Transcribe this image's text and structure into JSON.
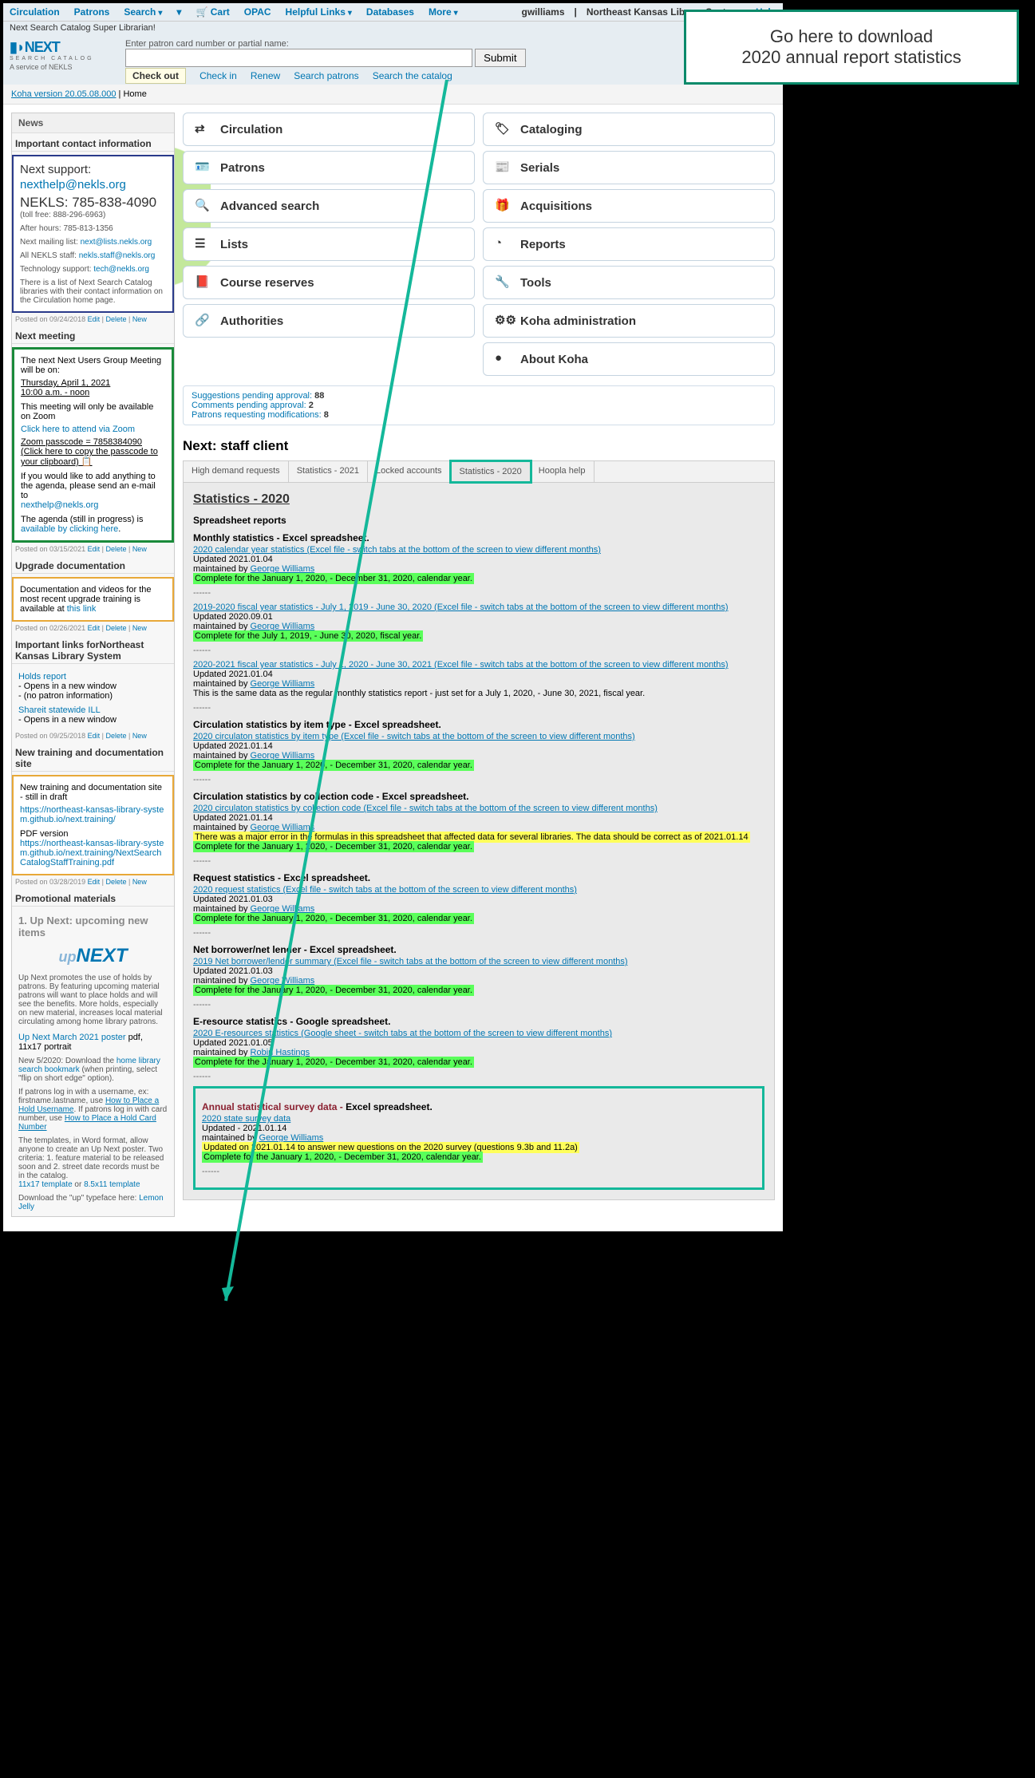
{
  "topnav": {
    "items": [
      "Circulation",
      "Patrons",
      "Search",
      "",
      "Cart",
      "OPAC",
      "Helpful Links",
      "Databases",
      "More"
    ],
    "cart_icon": "cart-icon",
    "user": "gwilliams",
    "system": "Northeast Kansas Library System",
    "help": "Help"
  },
  "superbar": "Next Search Catalog Super Librarian!",
  "logo": {
    "title": "NEXT",
    "subtitle": "SEARCH CATALOG",
    "service": "A service of NEKLS"
  },
  "search": {
    "label": "Enter patron card number or partial name:",
    "submit": "Submit",
    "tabs": {
      "checkout": "Check out",
      "checkin": "Check in",
      "renew": "Renew",
      "searchp": "Search patrons",
      "searchc": "Search the catalog"
    }
  },
  "breadcrumb": {
    "koha": "Koha version 20.05.08.000",
    "home": "Home"
  },
  "callout": {
    "line1": "Go here to download",
    "line2": "2020 annual report statistics"
  },
  "news_h": "News",
  "contact": {
    "h": "Important contact information",
    "support_h": "Next support:",
    "support_email": "nexthelp@nekls.org",
    "phone": "NEKLS: 785-838-4090",
    "tollfree": "(toll free: 888-296-6963)",
    "after": "After hours: 785-813-1356",
    "ml_label": "Next mailing list: ",
    "ml_link": "next@lists.nekls.org",
    "staff_label": "All NEKLS staff: ",
    "staff_link": "nekls.staff@nekls.org",
    "tech_label": "Technology support: ",
    "tech_link": "tech@nekls.org",
    "blurb": "There is a list of Next Search Catalog libraries with their contact information on the Circulation home page.",
    "posted": "Posted on 09/24/2018"
  },
  "meeting": {
    "h": "Next meeting",
    "l1": "The next Next Users Group Meeting will be on:",
    "date": "Thursday, April 1, 2021",
    "time": "10:00 a.m. - noon",
    "zoom_only": "This meeting will only be available on Zoom",
    "zoom_link": "Click here to attend via Zoom",
    "pass": "Zoom passcode = 7858384090 (Click here to copy the passcode to your clipboard)",
    "agenda1": "If you would like to add anything to the agenda, please send an e-mail to",
    "agenda_email": "nexthelp@nekls.org",
    "agenda2": "The agenda (still in progress) is ",
    "agenda_link": "available by clicking here",
    "posted": "Posted on 03/15/2021"
  },
  "upgrade": {
    "h": "Upgrade documentation",
    "text": "Documentation and videos for the most recent upgrade training is available at ",
    "link": "this link",
    "posted": "Posted on 02/26/2021"
  },
  "links": {
    "h": "Important links forNortheast Kansas Library System",
    "holds": "Holds report",
    "holds1": "- Opens in a new window",
    "holds2": "- (no patron information)",
    "ill": "Shareit statewide ILL",
    "ill1": "- Opens in a new window",
    "posted": "Posted on 09/25/2018"
  },
  "training": {
    "h": "New training and documentation site",
    "l1": "New training and documentation site - still in draft",
    "link1": "https://northeast-kansas-library-system.github.io/next.training/",
    "pdf": "PDF version",
    "link2": "https://northeast-kansas-library-system.github.io/next.training/NextSearchCatalogStaffTraining.pdf",
    "posted": "Posted on 03/28/2019"
  },
  "promo": {
    "h": "Promotional materials",
    "sub": "1. Up Next: upcoming new items",
    "blurb": "Up Next promotes the use of holds by patrons. By featuring upcoming material patrons will want to place holds and will see the benefits. More holds, especially on new material, increases local material circulating among home library patrons.",
    "poster_label": "Up Next March 2021 poster",
    "poster_fmt": " pdf, 11x17 portrait",
    "dl": "New 5/2020: Download the ",
    "dl_link": "home library search bookmark",
    "dl_end": " (when printing, select \"flip on short edge\" option).",
    "userlog": "If patrons log in with a username, ex: firstname.lastname, use ",
    "userlog_link": "How to Place a Hold Username",
    "cardlog": ". If patrons log in with card number, use ",
    "cardlog_link": "How to Place a Hold Card Number",
    "templates": "The templates, in Word format, allow anyone to create an Up Next poster. Two criteria: 1. feature material to be released soon and 2. street date records must be in the catalog.",
    "t1": "11x17 template",
    "or": " or ",
    "t2": "8.5x11 template",
    "typeface": "Download the \"up\" typeface here: ",
    "typeface_link": "Lemon Jelly"
  },
  "modules": {
    "left": [
      "Circulation",
      "Patrons",
      "Advanced search",
      "Lists",
      "Course reserves",
      "Authorities"
    ],
    "right": [
      "Cataloging",
      "Serials",
      "Acquisitions",
      "Reports",
      "Tools",
      "Koha administration",
      "About Koha"
    ]
  },
  "alerts": {
    "sugg": "Suggestions pending approval: ",
    "sugg_n": "88",
    "comm": "Comments pending approval: ",
    "comm_n": "2",
    "patr": "Patrons requesting modifications: ",
    "patr_n": "8"
  },
  "staff_h": "Next: staff client",
  "tabs": [
    "High demand requests",
    "Statistics - 2021",
    "Locked accounts",
    "Statistics - 2020",
    "Hoopla help"
  ],
  "stats": {
    "title": "Statistics - 2020",
    "spread_h": "Spreadsheet reports",
    "monthly_h": "Monthly statistics - Excel spreadsheet.",
    "r1_link": "2020 calendar year statistics (Excel file - switch tabs at the bottom of the screen to view different months)",
    "r1_upd": "Updated 2021.01.04",
    "maint_by": "maintained by ",
    "gw": "George Williams",
    "rh": "Robin Hastings",
    "r1_status": "Complete for the January 1, 2020, - December 31, 2020, calendar year.",
    "dash": "------",
    "r2_link": "2019-2020 fiscal year statistics - July 1, 2019 - June 30, 2020 (Excel file - switch tabs at the bottom of the screen to view different months)",
    "r2_upd": "Updated 2020.09.01",
    "r2_status": "Complete for the July 1, 2019, - June 30, 2020, fiscal year.",
    "r3_link": "2020-2021 fiscal year statistics - July 1, 2020 - June 30, 2021 (Excel file - switch tabs at the bottom of the screen to view different months)",
    "r3_upd": "Updated 2021.01.04",
    "r3_note": "This is the same data as the regular monthly statistics report - just set for a July 1, 2020, - June 30, 2021, fiscal year.",
    "item_h": "Circulation statistics by item type - Excel spreadsheet.",
    "r4_link": "2020 circulaton statistics by item type (Excel file - switch tabs at the bottom of the screen to view different months)",
    "r4_upd": "Updated 2021.01.14",
    "r4_status": "Complete for the January 1, 2020, - December 31, 2020, calendar year.",
    "coll_h": "Circulation statistics by collection code - Excel spreadsheet.",
    "r5_link": "2020 circulaton statistics by collection code (Excel file - switch tabs at the bottom of the screen to view different months)",
    "r5_upd": "Updated 2021.01.14",
    "r5_warn": "There was a major error in the formulas in this spreadsheet that affected data for several libraries. The data should be correct as of 2021.01.14",
    "r5_status": "Complete for the January 1, 2020, - December 31, 2020, calendar year.",
    "req_h": "Request statistics - Excel spreadsheet.",
    "r6_link": "2020 request statistics (Excel file - switch tabs at the bottom of the screen to view different months)",
    "r6_upd": "Updated 2021.01.03",
    "r6_status": "Complete for the January 1, 2020, - December 31, 2020, calendar year.",
    "net_h": "Net borrower/net lender - Excel spreadsheet.",
    "r7_link": "2019 Net borrower/lender summary (Excel file - switch tabs at the bottom of the screen to view different months)",
    "r7_upd": "Updated 2021.01.03",
    "r7_status": "Complete for the January 1, 2020, - December 31, 2020, calendar year.",
    "er_h": "E-resource statistics - Google spreadsheet.",
    "r8_link": "2020 E-resources statistics (Google sheet - switch tabs at the bottom of the screen to view different months)",
    "r8_upd": "Updated 2021.01.05",
    "r8_status": "Complete for the January 1, 2020, - December 31, 2020, calendar year.",
    "annual_h": "Annual statistical survey data - ",
    "annual_h2": "Excel spreadsheet.",
    "r9_link": "2020 state survey data",
    "r9_upd": "Updated - 2021.01.14",
    "r9_note": "Updated on 2021.01.14 to answer new questions on the 2020 survey (questions 9.3b and 11.2a)",
    "r9_status": "Complete for the January 1, 2020, - December 31, 2020, calendar year."
  },
  "editlinks": {
    "edit": "Edit",
    "delete": "Delete",
    "new": "New"
  }
}
